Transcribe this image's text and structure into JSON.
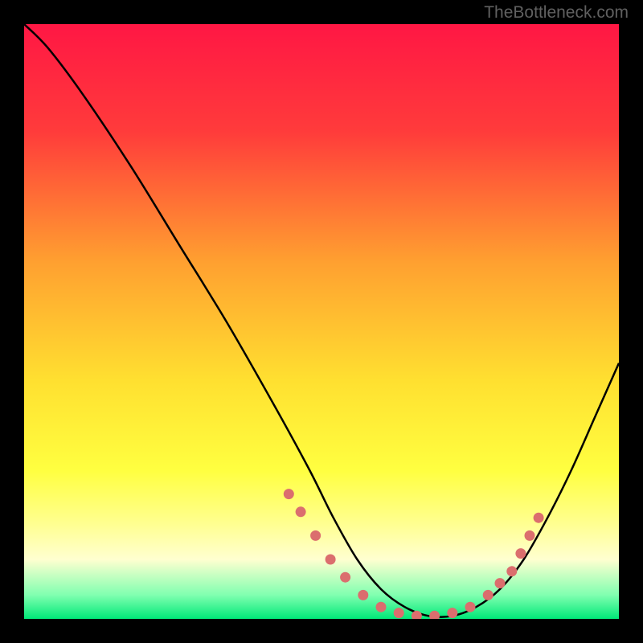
{
  "watermark": "TheBottleneck.com",
  "chart_data": {
    "type": "line",
    "title": "",
    "xlabel": "",
    "ylabel": "",
    "xlim": [
      0,
      100
    ],
    "ylim": [
      0,
      100
    ],
    "gradient_stops": [
      {
        "offset": 0,
        "color": "#ff1744"
      },
      {
        "offset": 18,
        "color": "#ff3b3b"
      },
      {
        "offset": 40,
        "color": "#ffa030"
      },
      {
        "offset": 60,
        "color": "#ffe030"
      },
      {
        "offset": 75,
        "color": "#ffff40"
      },
      {
        "offset": 84,
        "color": "#ffff90"
      },
      {
        "offset": 90,
        "color": "#ffffd0"
      },
      {
        "offset": 96,
        "color": "#80ffb0"
      },
      {
        "offset": 100,
        "color": "#00e878"
      }
    ],
    "series": [
      {
        "name": "bottleneck-curve",
        "x": [
          0,
          4,
          10,
          18,
          26,
          34,
          42,
          48,
          52,
          56,
          60,
          64,
          68,
          72,
          76,
          80,
          84,
          88,
          92,
          96,
          100
        ],
        "y": [
          100,
          96,
          88,
          76,
          63,
          50,
          36,
          25,
          17,
          10,
          5,
          2,
          0.5,
          0.5,
          2,
          5,
          10,
          17,
          25,
          34,
          43
        ]
      }
    ],
    "highlight_dots": {
      "name": "threshold-markers",
      "x": [
        44.5,
        46.5,
        49,
        51.5,
        54,
        57,
        60,
        63,
        66,
        69,
        72,
        75,
        78,
        80,
        82,
        83.5,
        85,
        86.5
      ],
      "y": [
        21,
        18,
        14,
        10,
        7,
        4,
        2,
        1,
        0.5,
        0.5,
        1,
        2,
        4,
        6,
        8,
        11,
        14,
        17
      ]
    }
  }
}
